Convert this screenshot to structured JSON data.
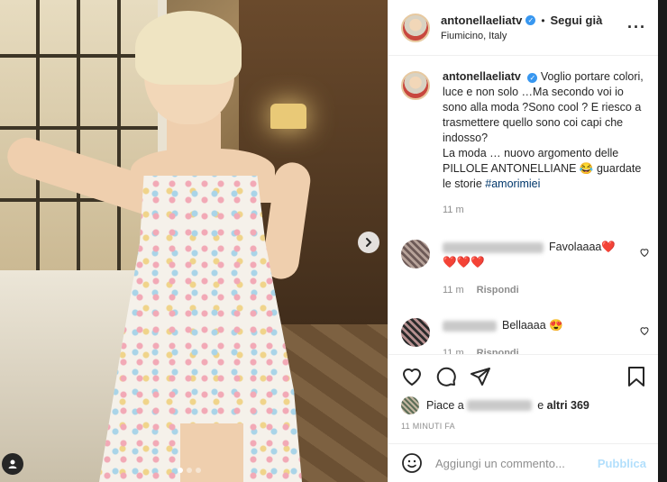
{
  "post": {
    "username": "antonellaeliatv",
    "follow_label": "Segui già",
    "location": "Fiumicino, Italy",
    "caption_text": "Voglio portare colori, luce e non solo …Ma secondo voi io sono alla moda ?Sono cool ? E riesco a trasmettere quello sono coi capi che indosso?\nLa moda … nuovo argomento delle PILLOLE ANTONELLIANE 😂 guardate le storie",
    "hashtag": "#amorimiei",
    "caption_time": "11 m"
  },
  "comments": [
    {
      "text": "Favolaaaa❤️",
      "extra": "❤️❤️❤️",
      "time": "11 m",
      "reply_label": "Rispondi"
    },
    {
      "text": "Bellaaaa 😍",
      "time": "11 m",
      "reply_label": "Rispondi"
    }
  ],
  "likes": {
    "prefix": "Piace a",
    "middle": "e",
    "others": "altri 369"
  },
  "timestamp": "11 MINUTI FA",
  "composer": {
    "placeholder": "Aggiungi un commento...",
    "publish_label": "Pubblica"
  },
  "colors": {
    "verified": "#3897f0",
    "publish_disabled": "#b2dffc",
    "hashtag": "#00376b"
  },
  "carousel": {
    "total": 3,
    "active": 1
  }
}
